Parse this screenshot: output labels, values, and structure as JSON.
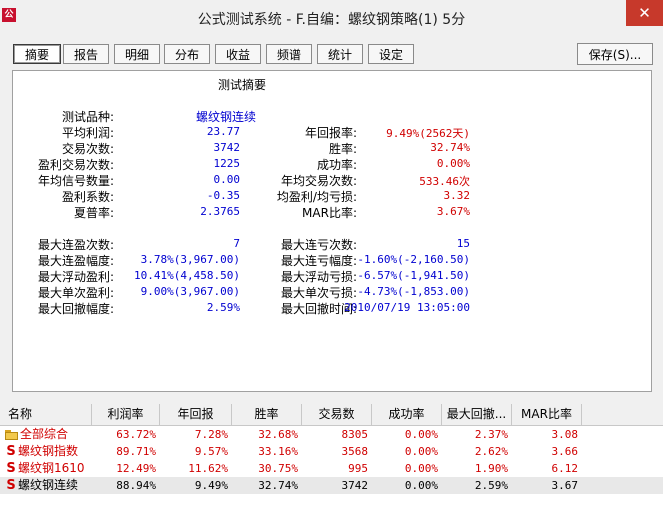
{
  "window": {
    "title": "公式测试系统 - F.自编：螺纹钢策略(1) 5分",
    "close_glyph": "✕"
  },
  "tabs": [
    {
      "label": "摘要"
    },
    {
      "label": "报告"
    },
    {
      "label": "明细"
    },
    {
      "label": "分布"
    },
    {
      "label": "收益"
    },
    {
      "label": "频谱"
    },
    {
      "label": "统计"
    },
    {
      "label": "设定"
    }
  ],
  "save_label": "保存(S)...",
  "summary": {
    "title": "测试摘要",
    "rows_left": [
      {
        "label": "测试品种:",
        "value": "螺纹钢连续"
      },
      {
        "label": "平均利润:",
        "value": "23.77"
      },
      {
        "label": "交易次数:",
        "value": "3742"
      },
      {
        "label": "盈利交易次数:",
        "value": "1225"
      },
      {
        "label": "年均信号数量:",
        "value": "0.00"
      },
      {
        "label": "盈利系数:",
        "value": "-0.35"
      },
      {
        "label": "夏普率:",
        "value": "2.3765"
      }
    ],
    "rows_right": [
      {
        "label": "年回报率:",
        "value": "9.49%(2562天)"
      },
      {
        "label": "胜率:",
        "value": "32.74%"
      },
      {
        "label": "成功率:",
        "value": "0.00%"
      },
      {
        "label": "年均交易次数:",
        "value": "533.46次"
      },
      {
        "label": "均盈利/均亏损:",
        "value": "3.32"
      },
      {
        "label": "MAR比率:",
        "value": "3.67%"
      }
    ],
    "streak_left": [
      {
        "label": "最大连盈次数:",
        "value": "7"
      },
      {
        "label": "最大连盈幅度:",
        "value": "3.78%(3,967.00)"
      },
      {
        "label": "最大浮动盈利:",
        "value": "10.41%(4,458.50)"
      },
      {
        "label": "最大单次盈利:",
        "value": "9.00%(3,967.00)"
      },
      {
        "label": "最大回撤幅度:",
        "value": "2.59%"
      }
    ],
    "streak_right": [
      {
        "label": "最大连亏次数:",
        "value": "15"
      },
      {
        "label": "最大连亏幅度:",
        "value": "-1.60%(-2,160.50)"
      },
      {
        "label": "最大浮动亏损:",
        "value": "-6.57%(-1,941.50)"
      },
      {
        "label": "最大单次亏损:",
        "value": "-4.73%(-1,853.00)"
      },
      {
        "label": "最大回撤时间:",
        "value": "2010/07/19 13:05:00"
      }
    ]
  },
  "grid": {
    "columns": [
      "名称",
      "利润率",
      "年回报",
      "胜率",
      "交易数",
      "成功率",
      "最大回撤...",
      "MAR比率"
    ],
    "rows": [
      {
        "icon": "folder",
        "name": "全部综合",
        "cells": [
          "63.72%",
          "7.28%",
          "32.68%",
          "8305",
          "0.00%",
          "2.37%",
          "3.08"
        ],
        "color": "#d00000"
      },
      {
        "icon": "S",
        "name": "螺纹钢指数",
        "cells": [
          "89.71%",
          "9.57%",
          "33.16%",
          "3568",
          "0.00%",
          "2.62%",
          "3.66"
        ],
        "color": "#d00000"
      },
      {
        "icon": "S",
        "name": "螺纹钢1610",
        "cells": [
          "12.49%",
          "11.62%",
          "30.75%",
          "995",
          "0.00%",
          "1.90%",
          "6.12"
        ],
        "color": "#d00000"
      },
      {
        "icon": "S",
        "name": "螺纹钢连续",
        "cells": [
          "88.94%",
          "9.49%",
          "32.74%",
          "3742",
          "0.00%",
          "2.59%",
          "3.67"
        ],
        "color": "#000000"
      }
    ]
  }
}
